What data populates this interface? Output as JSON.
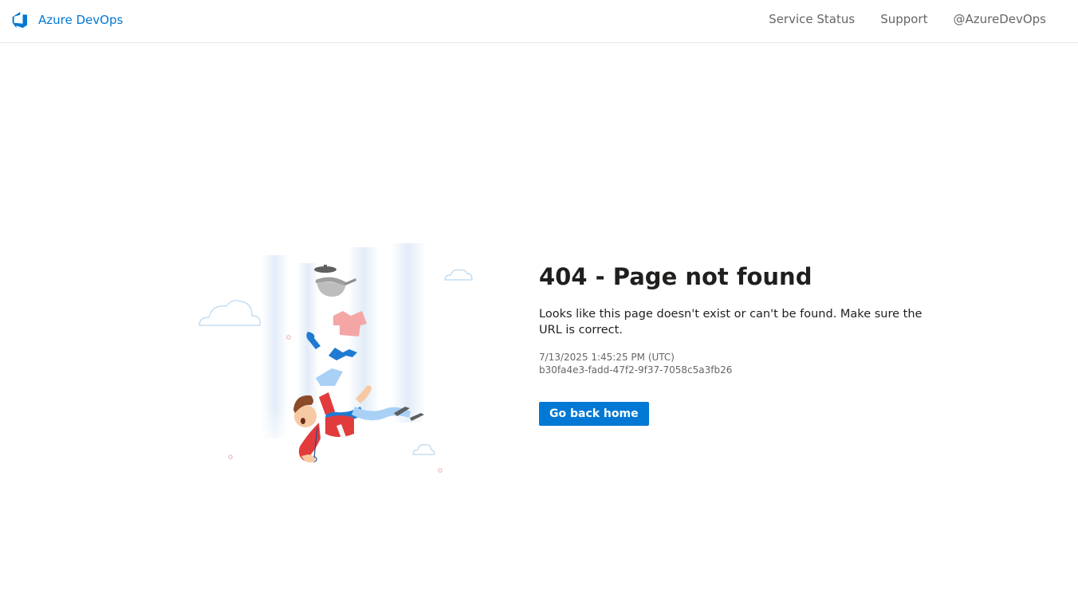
{
  "header": {
    "brand": "Azure DevOps",
    "nav": [
      "Service Status",
      "Support",
      "@AzureDevOps"
    ]
  },
  "main": {
    "title": "404 - Page not found",
    "message": "Looks like this page doesn't exist or can't be found. Make sure the URL is correct.",
    "timestamp": "7/13/2025 1:45:25 PM (UTC)",
    "activity_id": "b30fa4e3-fadd-47f2-9f37-7058c5a3fb26",
    "button": "Go back home"
  },
  "icons": {
    "logo": "azure-devops-logo-icon",
    "illustration": "falling-person-illustration"
  },
  "colors": {
    "accent": "#0078d4",
    "text": "#201f1e",
    "muted": "#666666",
    "border": "#e6e6e6"
  }
}
